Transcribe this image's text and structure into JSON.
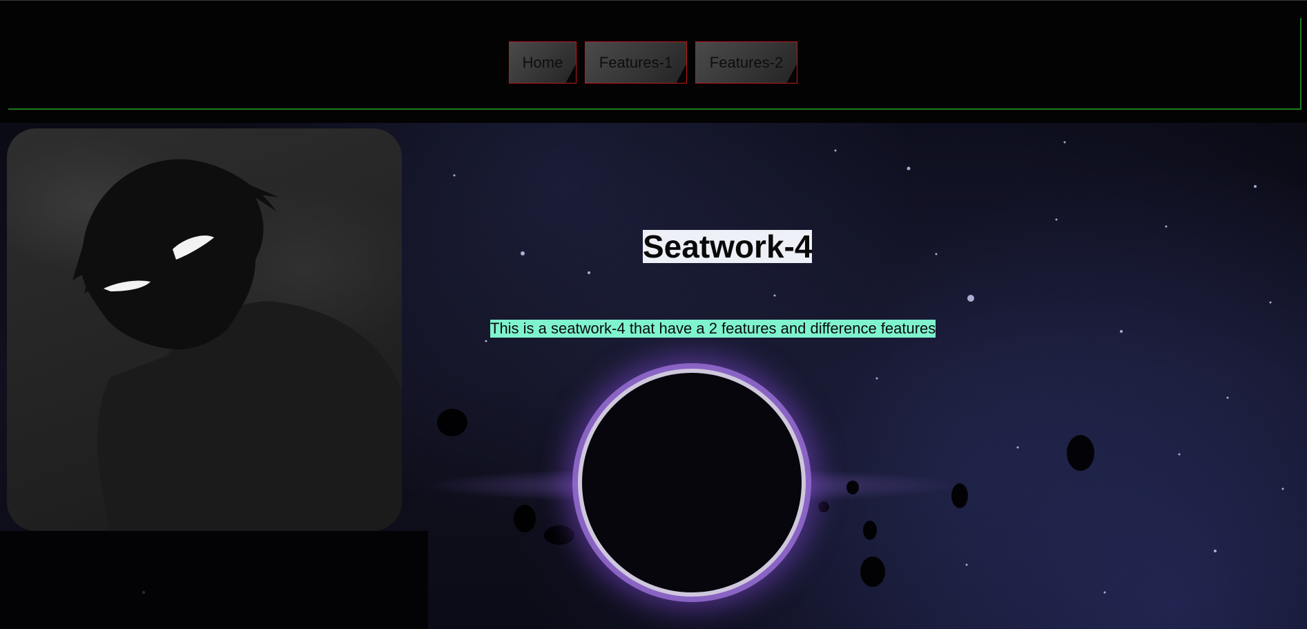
{
  "nav": {
    "items": [
      {
        "label": "Home"
      },
      {
        "label": "Features-1"
      },
      {
        "label": "Features-2"
      }
    ]
  },
  "hero": {
    "title": "Seatwork-4",
    "subtitle": "This is a seatwork-4 that have a 2 features and difference features"
  },
  "images": {
    "avatar": "hooded-figure-avatar",
    "background": "black-hole-space"
  },
  "colors": {
    "page_background": "#030303",
    "nav_border": "#c01717",
    "header_line": "#1c7a1c",
    "title_highlight": "#eef0f7",
    "subtitle_highlight": "#7ff3cf"
  }
}
